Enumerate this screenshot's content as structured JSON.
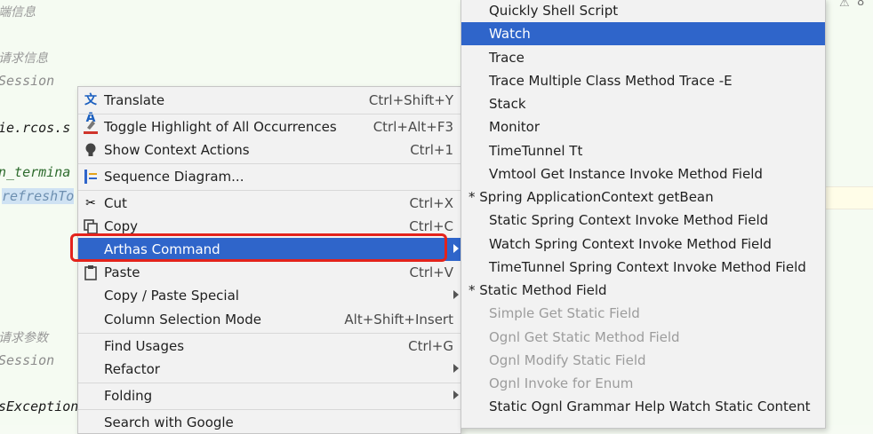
{
  "editor": {
    "lines": [
      {
        "text": "端信息"
      },
      {
        "text": "请求信息"
      },
      {
        "text": "Session"
      },
      {
        "text": "ie.rcos.s"
      },
      {
        "text": "n_termina"
      },
      {
        "text": "refreshTo"
      },
      {
        "text": "请求参数"
      },
      {
        "text": "Session"
      },
      {
        "text": "sException"
      }
    ],
    "warning_count": "8"
  },
  "context_menu": {
    "items": [
      {
        "label": "Translate",
        "shortcut": "Ctrl+Shift+Y",
        "icon": "translate-icon"
      },
      {
        "label": "Toggle Highlight of All Occurrences",
        "shortcut": "Ctrl+Alt+F3",
        "icon": "highlight-icon"
      },
      {
        "label": "Show Context Actions",
        "shortcut": "Ctrl+1",
        "icon": "bulb-icon"
      },
      {
        "label": "Sequence Diagram...",
        "shortcut": "",
        "icon": "sequence-diagram-icon"
      },
      {
        "label": "Cut",
        "shortcut": "Ctrl+X",
        "icon": "scissors-icon"
      },
      {
        "label": "Copy",
        "shortcut": "Ctrl+C",
        "icon": "copy-icon"
      },
      {
        "label": "Arthas Command",
        "shortcut": "",
        "icon": ""
      },
      {
        "label": "Paste",
        "shortcut": "Ctrl+V",
        "icon": "clipboard-icon"
      },
      {
        "label": "Copy / Paste Special",
        "shortcut": "",
        "icon": ""
      },
      {
        "label": "Column Selection Mode",
        "shortcut": "Alt+Shift+Insert",
        "icon": ""
      },
      {
        "label": "Find Usages",
        "shortcut": "Ctrl+G",
        "icon": ""
      },
      {
        "label": "Refactor",
        "shortcut": "",
        "icon": ""
      },
      {
        "label": "Folding",
        "shortcut": "",
        "icon": ""
      },
      {
        "label": "Search with Google",
        "shortcut": "",
        "icon": ""
      }
    ]
  },
  "submenu": {
    "items": [
      {
        "label": "Quickly Shell Script"
      },
      {
        "label": "Watch"
      },
      {
        "label": "Trace"
      },
      {
        "label": "Trace Multiple Class Method Trace -E"
      },
      {
        "label": "Stack"
      },
      {
        "label": "Monitor"
      },
      {
        "label": "TimeTunnel Tt"
      },
      {
        "label": "Vmtool Get Instance Invoke Method Field"
      },
      {
        "label": "* Spring ApplicationContext getBean"
      },
      {
        "label": "Static Spring Context Invoke  Method Field"
      },
      {
        "label": "Watch Spring Context Invoke Method Field"
      },
      {
        "label": "TimeTunnel Spring Context Invoke Method Field"
      },
      {
        "label": "*  Static Method Field"
      },
      {
        "label": "Simple Get Static Field"
      },
      {
        "label": "Ognl Get Static Method Field"
      },
      {
        "label": "Ognl Modify Static Field"
      },
      {
        "label": "Ognl Invoke for Enum"
      },
      {
        "label": "Static Ognl Grammar Help Watch Static Content"
      }
    ]
  },
  "colors": {
    "selection": "#2f65ca",
    "highlight_outline": "#e3231c",
    "editor_bg": "#f5fbf2"
  }
}
